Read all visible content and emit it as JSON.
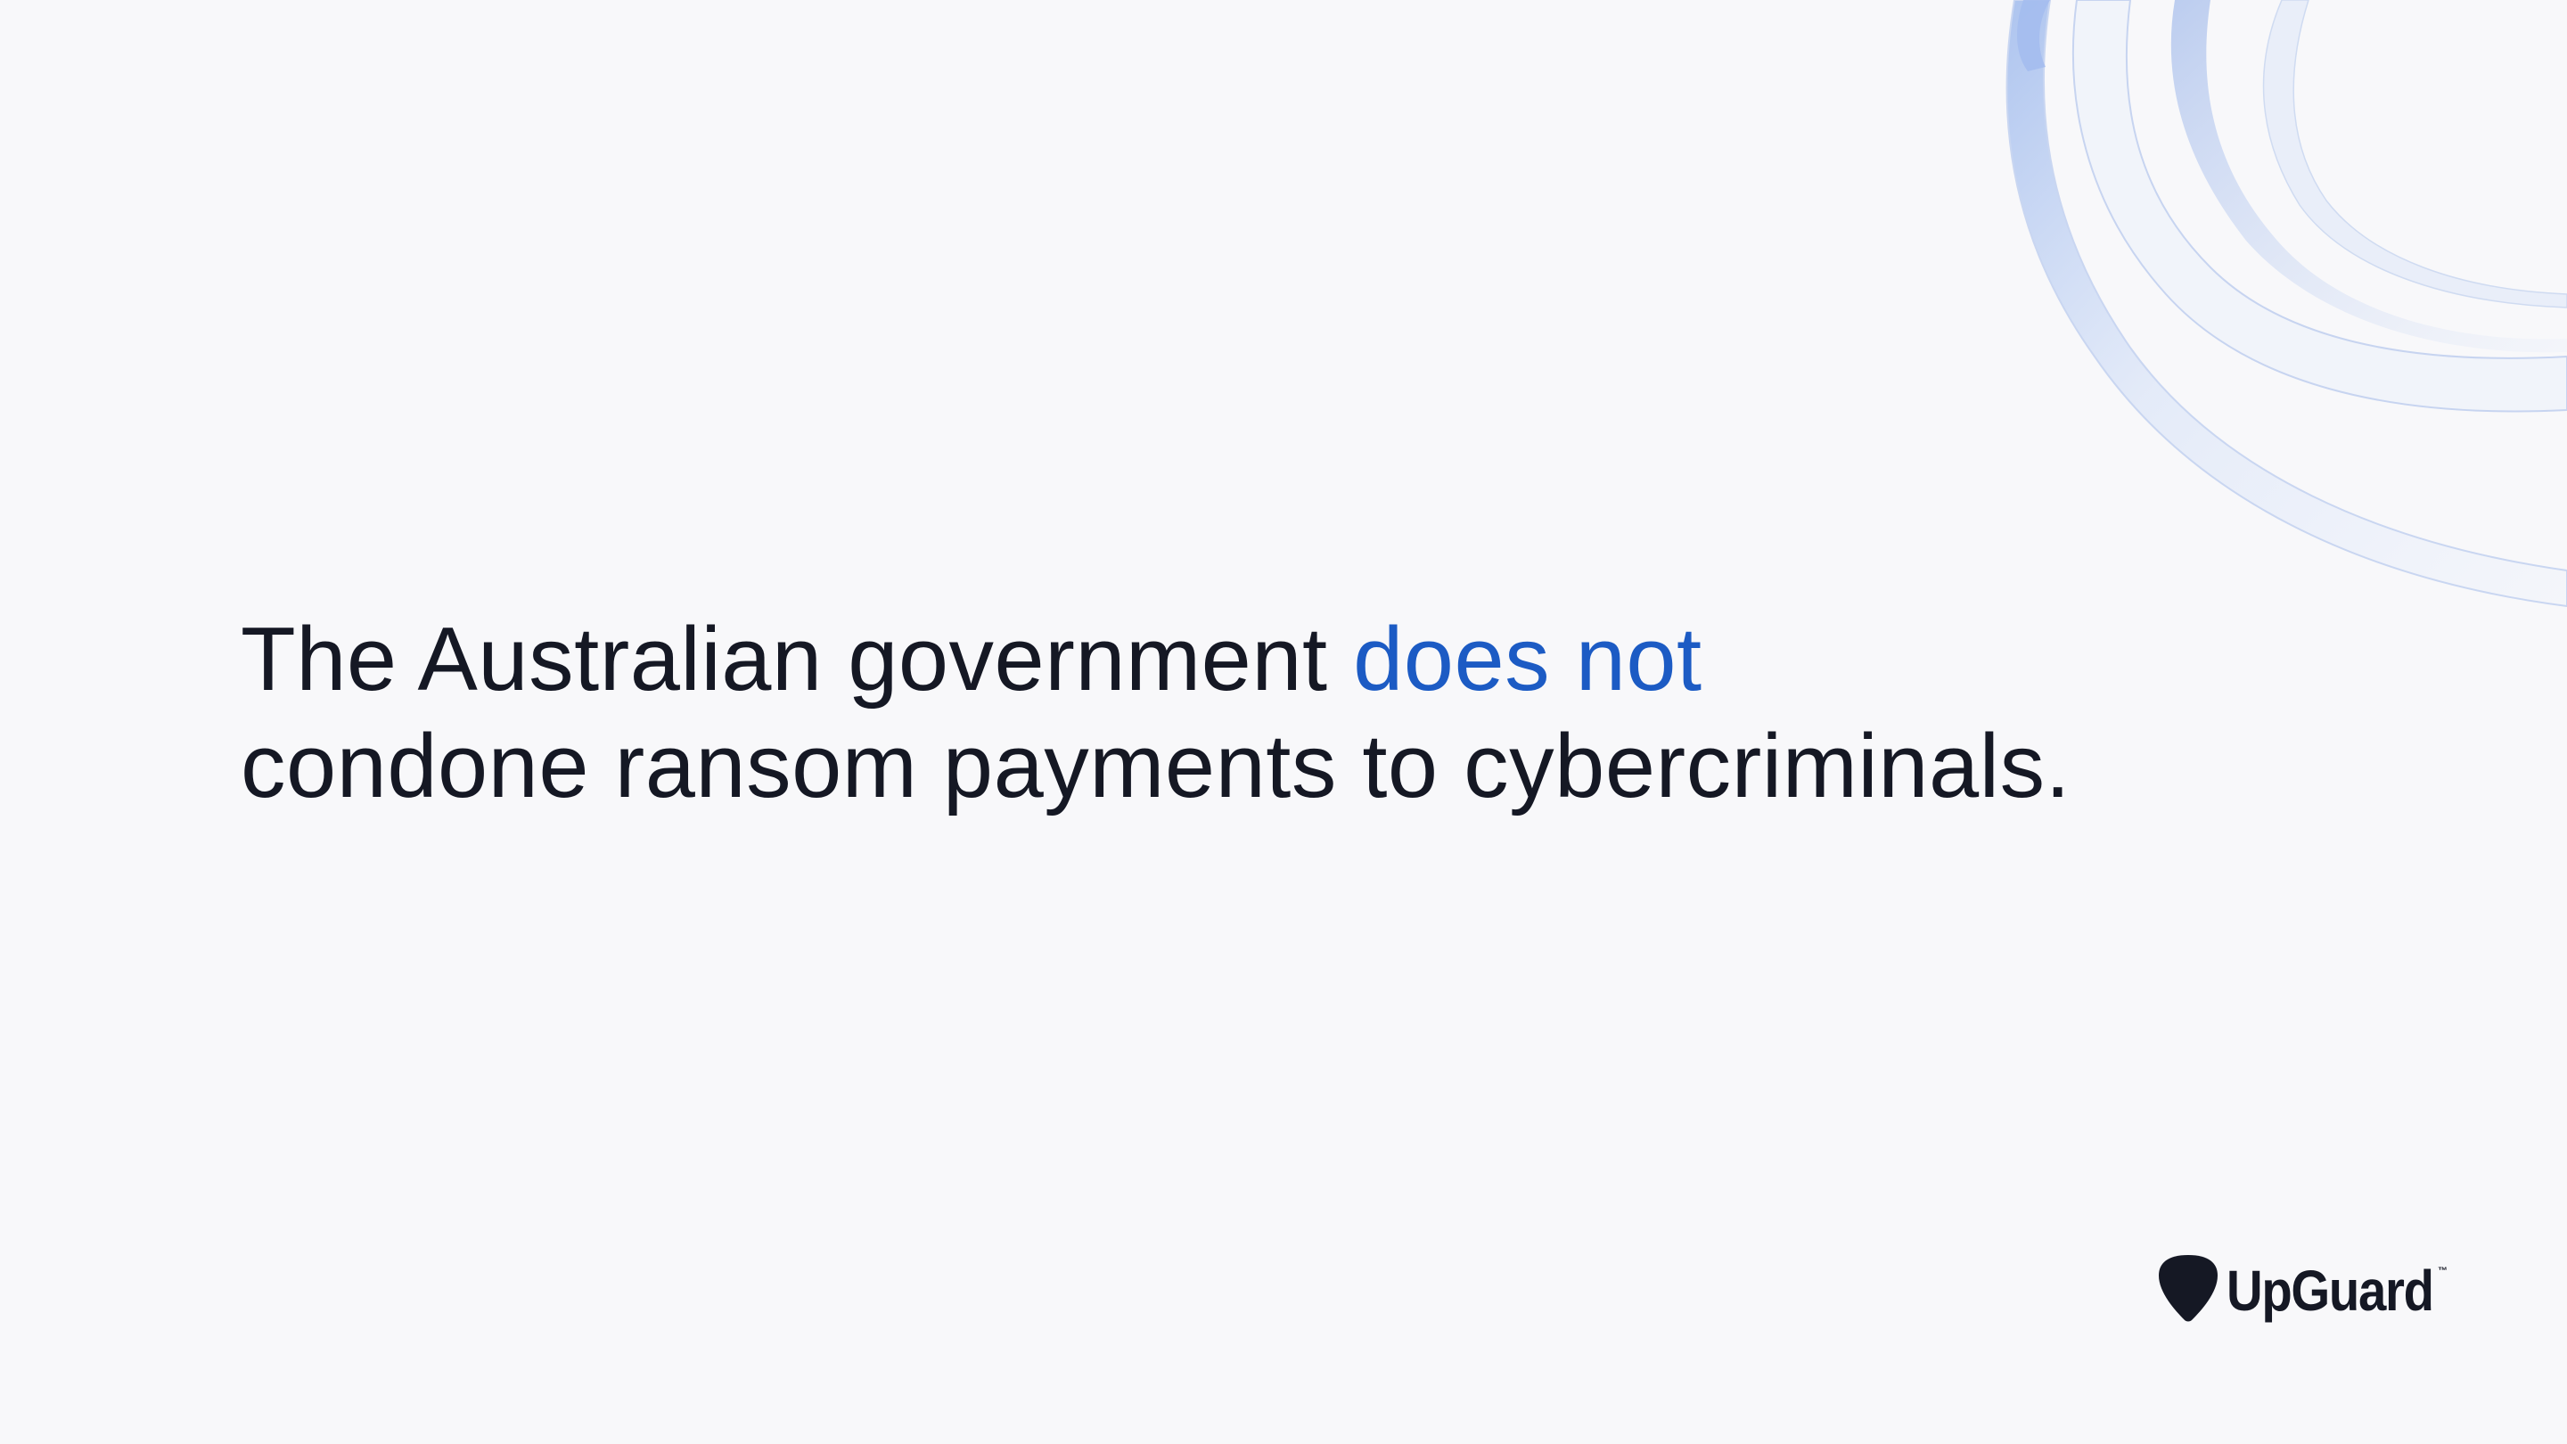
{
  "headline": {
    "line1_prefix": "The Australian government ",
    "line1_accent": "does not",
    "line2": "condone ransom payments to cybercriminals."
  },
  "logo": {
    "name": "UpGuard",
    "trademark": "™",
    "icon": "upguard-pick-icon"
  },
  "colors": {
    "background": "#f8f8fa",
    "text": "#151824",
    "accent": "#1c5bc4",
    "decor": "#a9bfe6"
  }
}
